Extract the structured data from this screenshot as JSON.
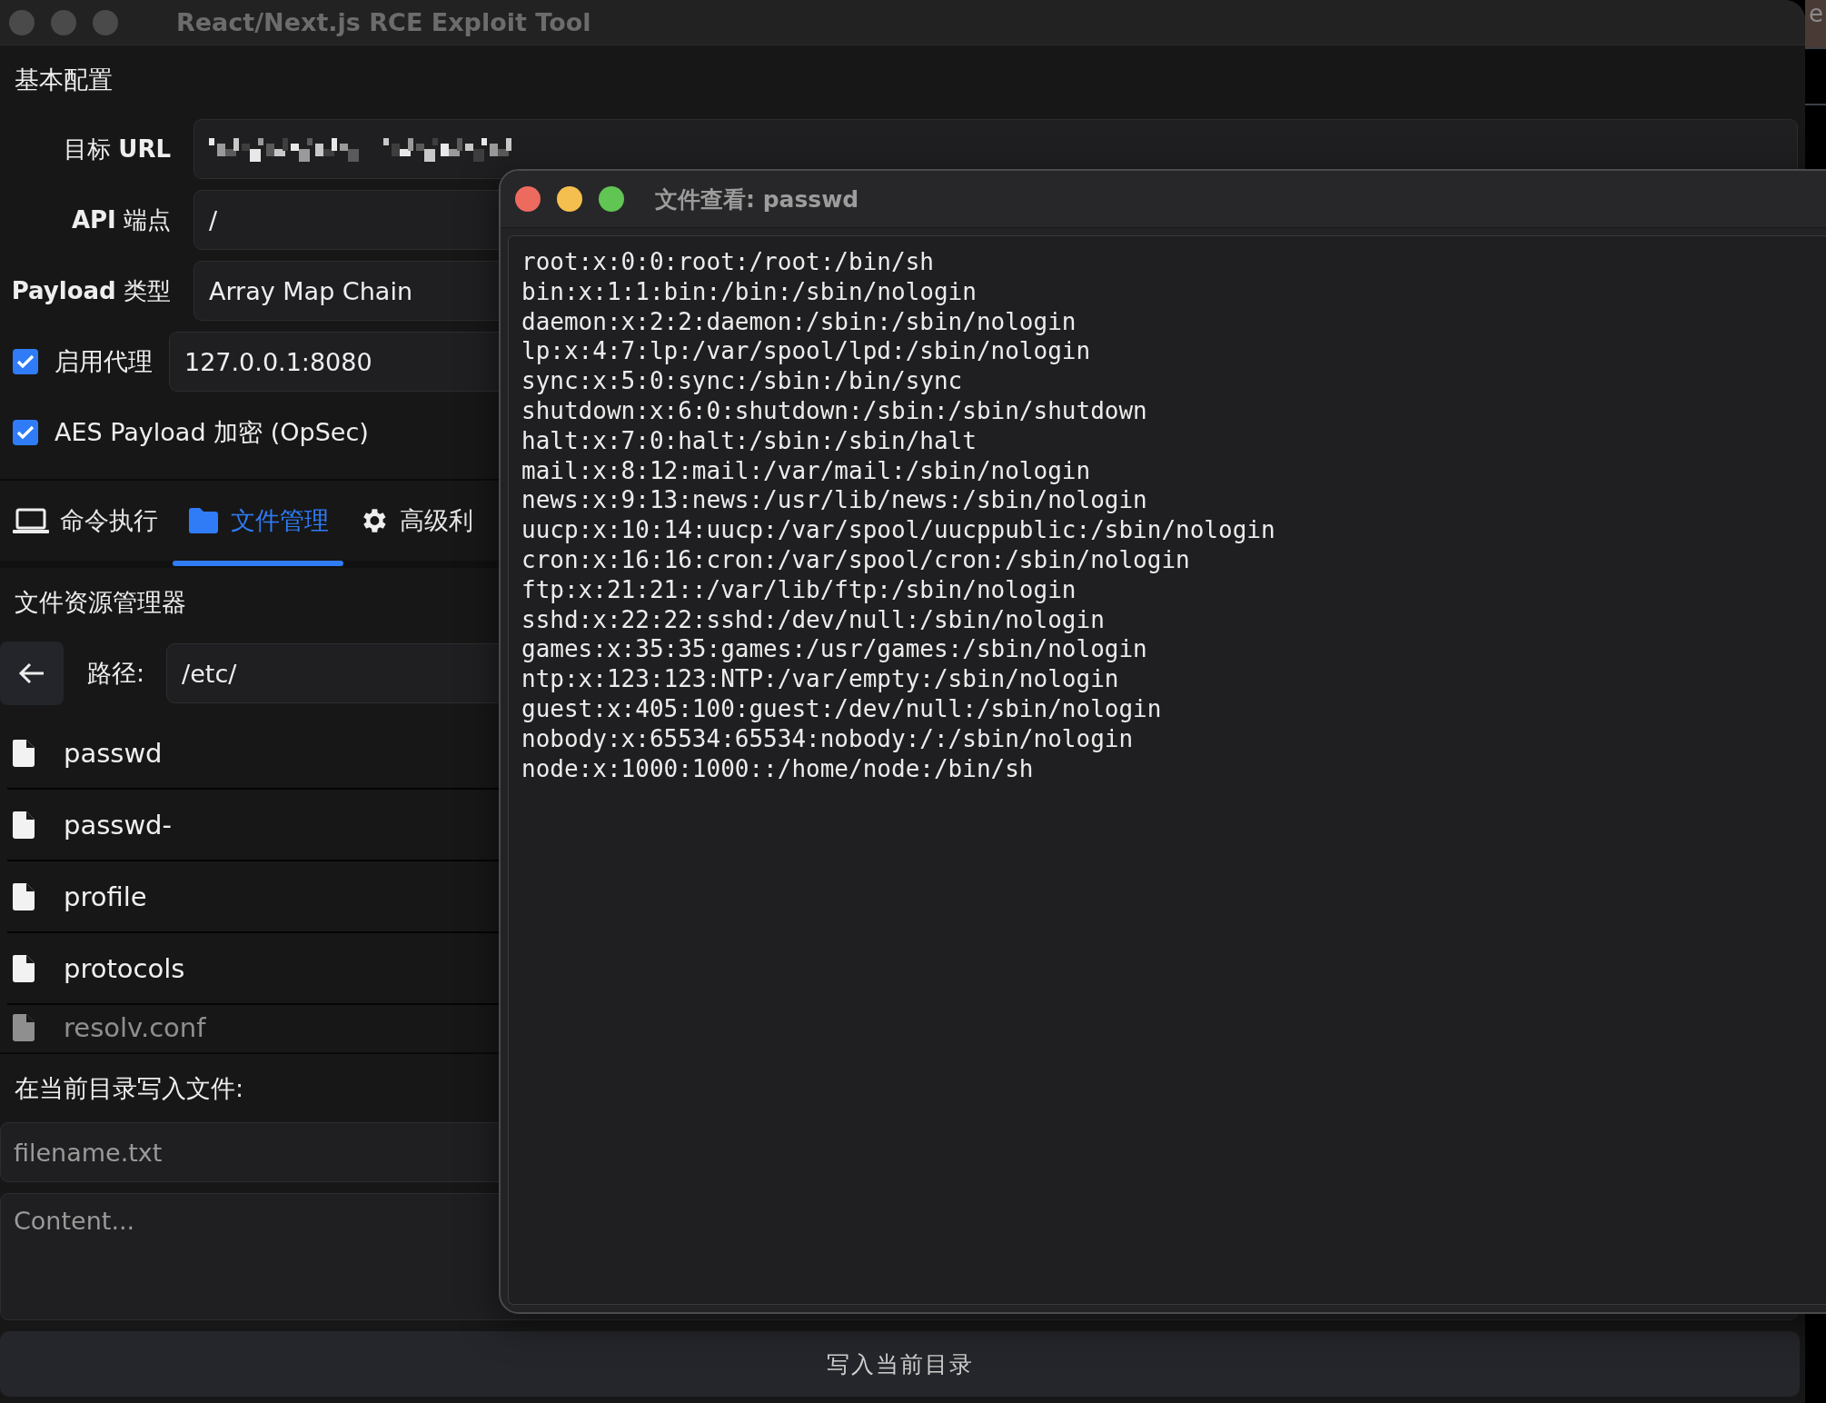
{
  "window": {
    "title": "React/Next.js RCE Exploit Tool"
  },
  "config": {
    "heading": "基本配置",
    "fields": [
      {
        "kind": "redacted",
        "label": "目标 **URL**"
      },
      {
        "kind": "text",
        "label": "**API** 端点",
        "value": "/"
      },
      {
        "kind": "text",
        "label": "**Payload** 类型",
        "value": "Array Map Chain"
      }
    ],
    "toggles": [
      {
        "label": "启用代理",
        "checked": true,
        "value": "127.0.0.1:8080"
      },
      {
        "label": "AES Payload 加密 (OpSec)",
        "checked": true
      }
    ]
  },
  "tabs": [
    {
      "kind": "terminal",
      "label": "命令执行",
      "selected": false
    },
    {
      "kind": "files",
      "label": "文件管理",
      "selected": true
    },
    {
      "kind": "advanced",
      "label": "高级利",
      "selected": false
    }
  ],
  "explorer": {
    "heading": "文件资源管理器",
    "path_label": "路径:",
    "path": "/etc/",
    "files": [
      "passwd",
      "passwd-",
      "profile",
      "protocols",
      "resolv.conf"
    ]
  },
  "writer": {
    "heading": "在当前目录写入文件:",
    "filename_placeholder": "filename.txt",
    "content_placeholder": "Content...",
    "button": "写入当前目录"
  },
  "viewer": {
    "title": "文件查看: passwd",
    "lines": [
      "root:x:0:0:root:/root:/bin/sh",
      "bin:x:1:1:bin:/bin:/sbin/nologin",
      "daemon:x:2:2:daemon:/sbin:/sbin/nologin",
      "lp:x:4:7:lp:/var/spool/lpd:/sbin/nologin",
      "sync:x:5:0:sync:/sbin:/bin/sync",
      "shutdown:x:6:0:shutdown:/sbin:/sbin/shutdown",
      "halt:x:7:0:halt:/sbin:/sbin/halt",
      "mail:x:8:12:mail:/var/mail:/sbin/nologin",
      "news:x:9:13:news:/usr/lib/news:/sbin/nologin",
      "uucp:x:10:14:uucp:/var/spool/uucppublic:/sbin/nologin",
      "cron:x:16:16:cron:/var/spool/cron:/sbin/nologin",
      "ftp:x:21:21::/var/lib/ftp:/sbin/nologin",
      "sshd:x:22:22:sshd:/dev/null:/sbin/nologin",
      "games:x:35:35:games:/usr/games:/sbin/nologin",
      "ntp:x:123:123:NTP:/var/empty:/sbin/nologin",
      "guest:x:405:100:guest:/dev/null:/sbin/nologin",
      "nobody:x:65534:65534:nobody:/:/sbin/nologin",
      "node:x:1000:1000::/home/node:/bin/sh"
    ]
  },
  "background_window": {
    "text": "e"
  }
}
